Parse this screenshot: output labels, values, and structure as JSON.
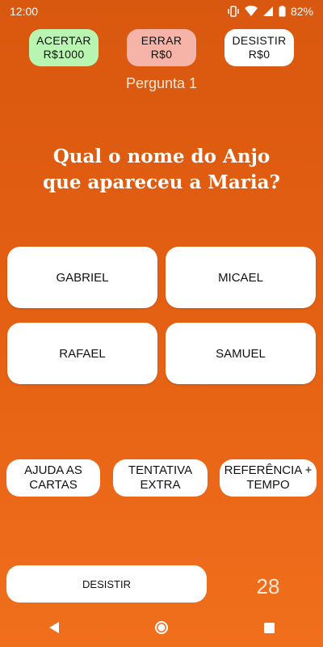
{
  "status_bar": {
    "time": "12:00",
    "battery": "82%",
    "icons": [
      "vibrate-icon",
      "wifi-icon",
      "signal-icon",
      "battery-icon"
    ]
  },
  "score": {
    "acertar": {
      "label": "ACERTAR",
      "value": "R$1000",
      "color": "#b8f5b0"
    },
    "errar": {
      "label": "ERRAR",
      "value": "R$0",
      "color": "#f6b3a8"
    },
    "desistir": {
      "label": "DESISTIR",
      "value": "R$0",
      "color": "#ffffff"
    }
  },
  "question": {
    "number_label": "Pergunta 1",
    "line1": "Qual o nome do Anjo",
    "line2": "que apareceu a Maria?"
  },
  "answers": [
    "GABRIEL",
    "MICAEL",
    "RAFAEL",
    "SAMUEL"
  ],
  "helps": {
    "cartas": {
      "line1": "AJUDA AS",
      "line2": "CARTAS"
    },
    "tentativa": {
      "line1": "TENTATIVA",
      "line2": "EXTRA"
    },
    "referencia": {
      "line1": "REFERÊNCIA +",
      "line2": "TEMPO"
    }
  },
  "quit_label": "DESISTIR",
  "timer": "28",
  "nav": {
    "back": "back-icon",
    "home": "home-icon",
    "recents": "recents-icon"
  },
  "theme": {
    "background_top": "#d9580f",
    "background_bottom": "#f06f1c"
  }
}
